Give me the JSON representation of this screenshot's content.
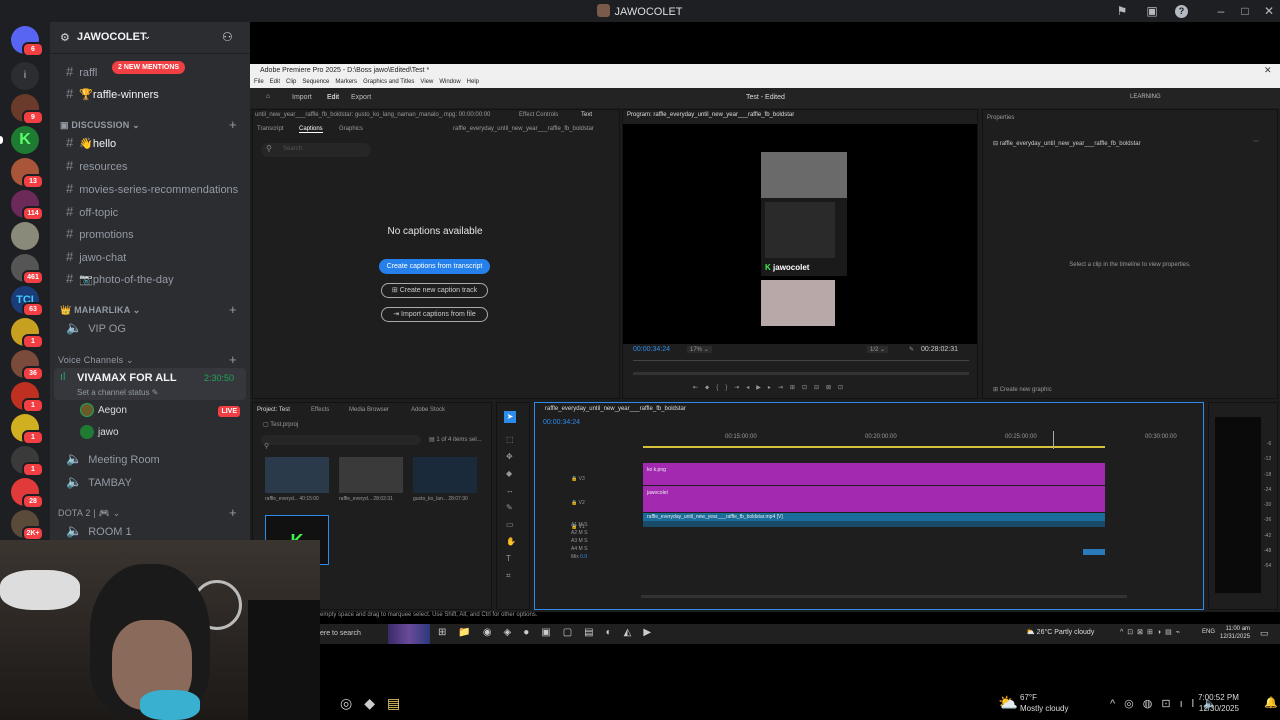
{
  "window": {
    "title": "JAWOCOLET"
  },
  "server": {
    "name": "JAWOCOLET",
    "mentions_label": "2 NEW MENTIONS",
    "rail_badges": [
      "6",
      "9",
      "13",
      "114",
      "461",
      "63",
      "1",
      "36",
      "1",
      "1",
      "1",
      "28",
      "1",
      "2K+"
    ]
  },
  "channels": {
    "top": [
      {
        "name": "raffl"
      },
      {
        "name": "🏆raffle-winners"
      }
    ],
    "discussion": {
      "label": "DISCUSSION",
      "items": [
        "👋hello",
        "resources",
        "movies-series-recommendations",
        "off-topic",
        "promotions",
        "jawo-chat",
        "📷photo-of-the-day"
      ]
    },
    "maharlika": {
      "label": "MAHARLIKA",
      "items": [
        "VIP OG"
      ]
    },
    "voice": {
      "label": "Voice Channels",
      "active": {
        "name": "VIVAMAX FOR ALL",
        "time": "2:30:50",
        "status": "Set a channel status"
      },
      "users": [
        {
          "name": "Aegon",
          "live": "LIVE"
        },
        {
          "name": "jawo",
          "live": ""
        }
      ],
      "others": [
        "Meeting Room",
        "TAMBAY"
      ]
    },
    "dota": {
      "label": "DOTA 2 |",
      "items": [
        "ROOM 1"
      ]
    }
  },
  "premiere": {
    "title": "Adobe Premiere Pro 2025 - D:\\Boss jawo\\Edited\\Test *",
    "menu": [
      "File",
      "Edit",
      "Clip",
      "Sequence",
      "Markers",
      "Graphics and Titles",
      "View",
      "Window",
      "Help"
    ],
    "workspace_tabs": [
      "Import",
      "Edit",
      "Export"
    ],
    "doc_title": "Test - Edited",
    "learning": "LEARNING",
    "captions": {
      "tabs": [
        "Transcript",
        "Captions",
        "Graphics"
      ],
      "clip": "raffle_everyday_until_new_year___raffle_fb_boldstar",
      "search_placeholder": "Search",
      "empty": "No captions available",
      "buttons": [
        "Create captions from transcript",
        "Create new caption track",
        "Import captions from file"
      ]
    },
    "source_bar": "until_new_year___raffle_fb_boldstar: gusto_ko_lang_naman_manalo_.mpg: 00:00:00:00",
    "source_tabs": [
      "Effect Controls",
      "Text"
    ],
    "program": {
      "title": "Program: raffle_everyday_until_new_year___raffle_fb_boldstar",
      "timecode": "00:00:34:24",
      "zoom": "17%",
      "res": "1/2",
      "duration": "00:28:02:31",
      "overlay_name": "jawocolet"
    },
    "properties": {
      "title": "Properties",
      "item": "raffle_everyday_until_new_year___raffle_fb_boldstar",
      "hint": "Select a clip in the timeline to view properties.",
      "new_graphic": "Create new graphic"
    },
    "project": {
      "tabs": [
        "Project: Test",
        "Effects",
        "Media Browser",
        "Adobe Stock"
      ],
      "file": "Test.prproj",
      "count": "1 of 4 items sel...",
      "items": [
        {
          "name": "raffle_everyd...",
          "dur": "40:15:00"
        },
        {
          "name": "raffle_everyd...",
          "dur": "28:02:31"
        },
        {
          "name": "gusto_ko_lan...",
          "dur": "28:07:30"
        }
      ]
    },
    "timeline": {
      "title": "raffle_everyday_until_new_year___raffle_fb_boldstar",
      "timecode": "00:00:34:24",
      "ruler": [
        "00:15:00:00",
        "00:20:00:00",
        "00:25:00:00",
        "00:30:00:00"
      ],
      "tracks": [
        "V3",
        "V2",
        "V1",
        "A1",
        "A2",
        "A3",
        "A4",
        "Mix"
      ],
      "clip_v3": "ko k.png",
      "clip_v2": "jawocolet",
      "clip_v1": "raffle_everyday_until_new_year___raffle_fb_boldstar.mp4 [V]",
      "mix_value": "0.0"
    },
    "meter": [
      "0",
      "-6",
      "-12",
      "-18",
      "-24",
      "-30",
      "-36",
      "-42",
      "-48",
      "-54"
    ],
    "status": "empty space and drag to marquee select. Use Shift, Alt, and Ctrl for other options."
  },
  "inner_taskbar": {
    "search": "ere to search",
    "weather": "26°C  Partly cloudy",
    "lang": "ENG",
    "time": "11:00 am",
    "date": "12/31/2025"
  },
  "outer_taskbar": {
    "temp": "67°F",
    "weather": "Mostly cloudy",
    "time": "7:00:52 PM",
    "date": "12/30/2025"
  }
}
